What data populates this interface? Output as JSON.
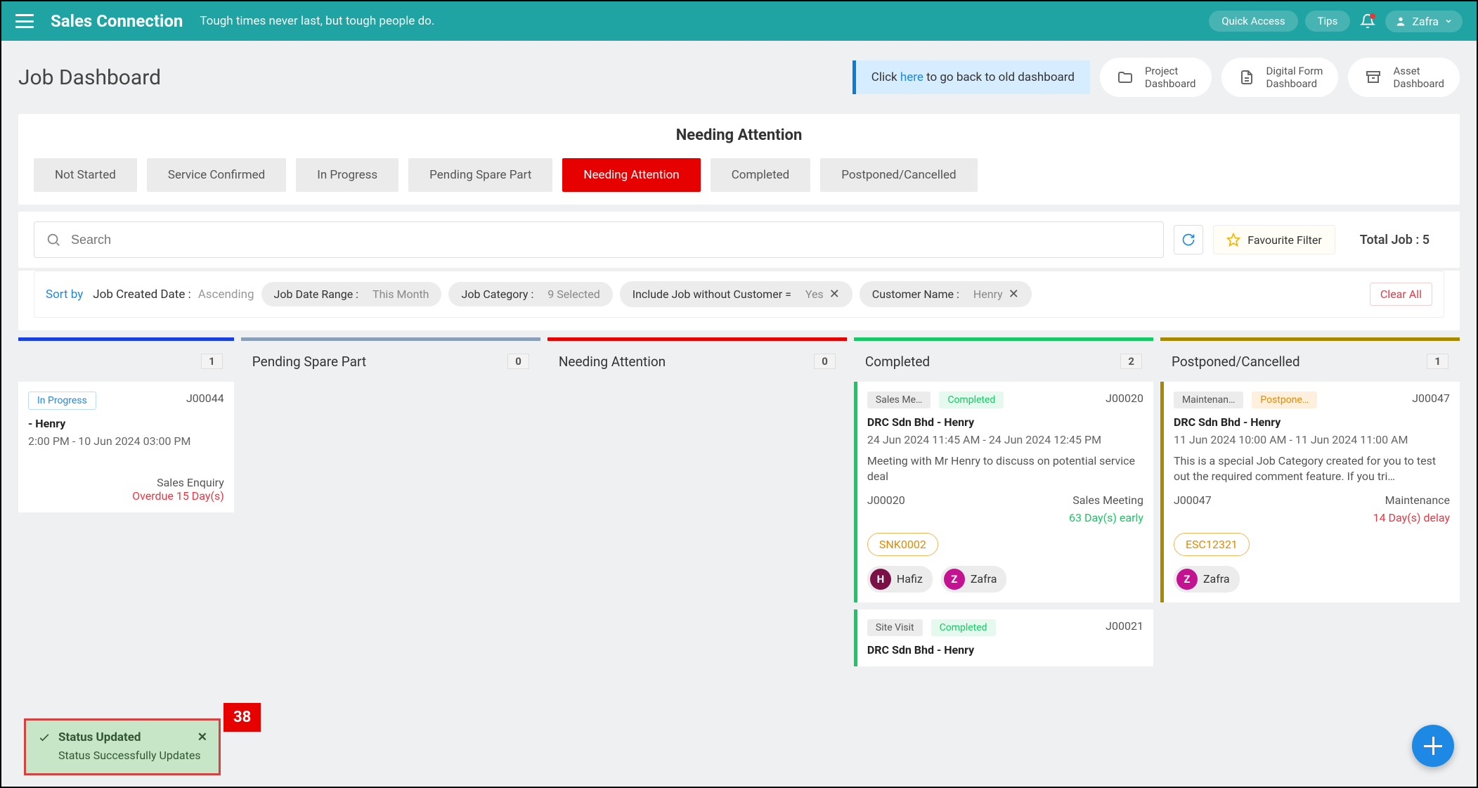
{
  "header": {
    "brand": "Sales Connection",
    "tagline": "Tough times never last, but tough people do.",
    "quick_access": "Quick Access",
    "tips": "Tips",
    "user_name": "Zafra"
  },
  "page": {
    "title": "Job Dashboard",
    "notice_prefix": "Click ",
    "notice_link": "here",
    "notice_suffix": " to go back to old dashboard",
    "dash_buttons": [
      {
        "line1": "Project",
        "line2": "Dashboard"
      },
      {
        "line1": "Digital Form",
        "line2": "Dashboard"
      },
      {
        "line1": "Asset",
        "line2": "Dashboard"
      }
    ]
  },
  "tabs": {
    "section_title": "Needing Attention",
    "items": [
      "Not Started",
      "Service Confirmed",
      "In Progress",
      "Pending Spare Part",
      "Needing Attention",
      "Completed",
      "Postponed/Cancelled"
    ],
    "active_index": 4
  },
  "search": {
    "placeholder": "Search",
    "favourite": "Favourite Filter",
    "total_job_label": "Total Job : ",
    "total_job_val": "5"
  },
  "filters": {
    "sort_by_label": "Sort by",
    "sort_field": "Job Created Date :",
    "sort_dir": "Ascending",
    "chips": [
      {
        "label": "Job Date Range :",
        "value": "This Month",
        "closable": false
      },
      {
        "label": "Job Category :",
        "value": "9 Selected",
        "closable": false
      },
      {
        "label": "Include Job without Customer =",
        "value": "Yes",
        "closable": true
      },
      {
        "label": "Customer Name :",
        "value": "Henry",
        "closable": true
      }
    ],
    "clear_all": "Clear All"
  },
  "columns": [
    {
      "title": "",
      "count": "1",
      "bar": "bar-blue",
      "cards": [
        {
          "edge": "",
          "tag1": "In Progress",
          "tag1cls": "chip-status-inprogress",
          "jobno": "J00044",
          "title": "- Henry",
          "sub": "2:00 PM - 10 Jun 2024 03:00 PM",
          "right1": "Sales Enquiry",
          "right2": "Overdue 15 Day(s)"
        }
      ]
    },
    {
      "title": "Pending Spare Part",
      "count": "0",
      "bar": "bar-grey",
      "cards": []
    },
    {
      "title": "Needing Attention",
      "count": "0",
      "bar": "bar-red",
      "cards": []
    },
    {
      "title": "Completed",
      "count": "2",
      "bar": "bar-green",
      "cards": [
        {
          "edge": "edge-green",
          "tag1": "Sales Me…",
          "tag2": "Completed",
          "tag2cls": "chip-status-completed",
          "jobno": "J00020",
          "title": "DRC Sdn Bhd - Henry",
          "sub": "24 Jun 2024 11:45 AM - 24 Jun 2024 12:45 PM",
          "desc": "Meeting with Mr Henry to discuss on potential service deal",
          "foot_l": "J00020",
          "foot_r": "Sales Meeting",
          "days": "63 Day(s) early",
          "days_cls": "days-early",
          "pill": "SNK0002",
          "avatars": [
            {
              "c": "H",
              "name": "Hafiz",
              "cls": "h"
            },
            {
              "c": "Z",
              "name": "Zafra",
              "cls": "z"
            }
          ]
        },
        {
          "edge": "edge-green",
          "tag1": "Site Visit",
          "tag2": "Completed",
          "tag2cls": "chip-status-completed",
          "jobno": "J00021",
          "title": "DRC Sdn Bhd - Henry"
        }
      ]
    },
    {
      "title": "Postponed/Cancelled",
      "count": "1",
      "bar": "bar-olive",
      "cards": [
        {
          "edge": "edge-olive",
          "tag1": "Maintenan…",
          "tag2": "Postpone…",
          "tag2cls": "chip-status-postponed",
          "jobno": "J00047",
          "title": "DRC Sdn Bhd - Henry",
          "sub": "11 Jun 2024 10:00 AM - 11 Jun 2024 11:00 AM",
          "desc": "This is a special Job Category created for you to test out the required comment feature. If you tri…",
          "foot_l": "J00047",
          "foot_r": "Maintenance",
          "days": "14 Day(s) delay",
          "days_cls": "days-delay",
          "pill": "ESC12321",
          "avatars": [
            {
              "c": "Z",
              "name": "Zafra",
              "cls": "z"
            }
          ]
        }
      ]
    }
  ],
  "toast": {
    "title": "Status Updated",
    "body": "Status Successfully Updates"
  },
  "red_badge": "38"
}
